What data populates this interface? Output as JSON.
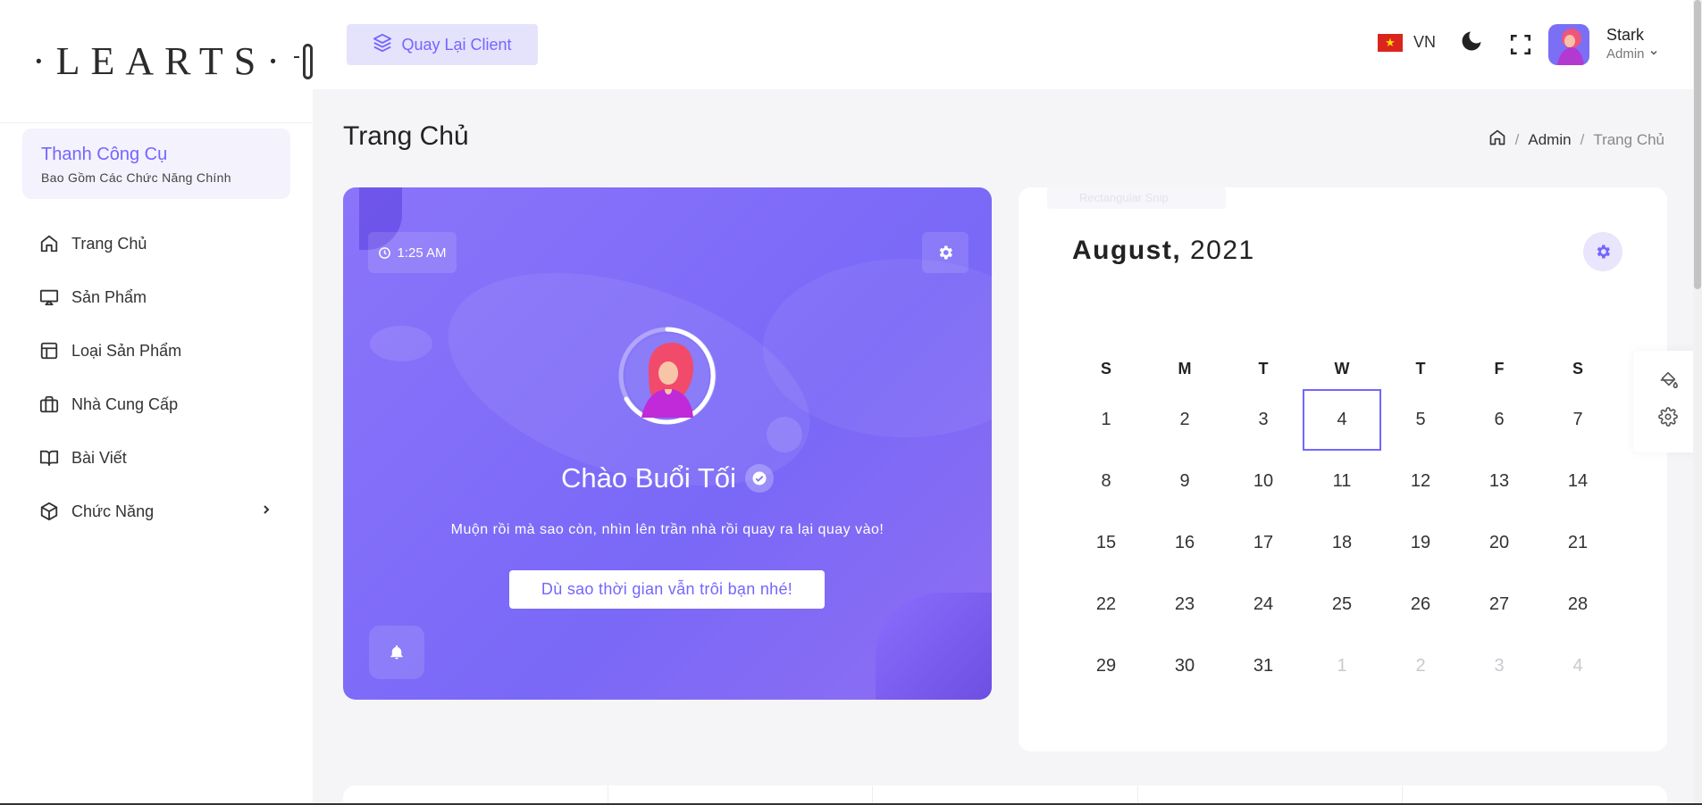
{
  "brand": {
    "logo_text": "·LEARTS·"
  },
  "sidebar": {
    "tool_title": "Thanh Công Cụ",
    "tool_subtitle": "Bao Gồm Các Chức Năng Chính",
    "items": [
      {
        "label": "Trang Chủ",
        "icon": "home-icon"
      },
      {
        "label": "Sản Phẩm",
        "icon": "monitor-icon"
      },
      {
        "label": "Loại Sản Phẩm",
        "icon": "layout-icon"
      },
      {
        "label": "Nhà Cung Cấp",
        "icon": "briefcase-icon"
      },
      {
        "label": "Bài Viết",
        "icon": "book-icon"
      },
      {
        "label": "Chức Năng",
        "icon": "box-icon"
      }
    ]
  },
  "header": {
    "back_label": "Quay Lại Client",
    "language": "VN",
    "user_name": "Stark",
    "user_role": "Admin"
  },
  "page": {
    "title": "Trang Chủ",
    "breadcrumb": [
      "Admin",
      "Trang Chủ"
    ]
  },
  "welcome": {
    "time": "1:25 AM",
    "greeting": "Chào Buổi Tối",
    "message": "Muộn rồi mà sao còn, nhìn lên trần nhà rồi quay ra lại quay vào!",
    "button_label": "Dù sao thời gian vẫn trôi bạn nhé!"
  },
  "calendar": {
    "ghost_text": "Rectangular Snip",
    "month": "August,",
    "year": "2021",
    "weekdays": [
      "S",
      "M",
      "T",
      "W",
      "T",
      "F",
      "S"
    ],
    "days": [
      [
        "1",
        "2",
        "3",
        "4",
        "5",
        "6",
        "7"
      ],
      [
        "8",
        "9",
        "10",
        "11",
        "12",
        "13",
        "14"
      ],
      [
        "15",
        "16",
        "17",
        "18",
        "19",
        "20",
        "21"
      ],
      [
        "22",
        "23",
        "24",
        "25",
        "26",
        "27",
        "28"
      ],
      [
        "29",
        "30",
        "31",
        "1",
        "2",
        "3",
        "4"
      ]
    ],
    "today": "4",
    "accent_color": "#7366ff"
  }
}
